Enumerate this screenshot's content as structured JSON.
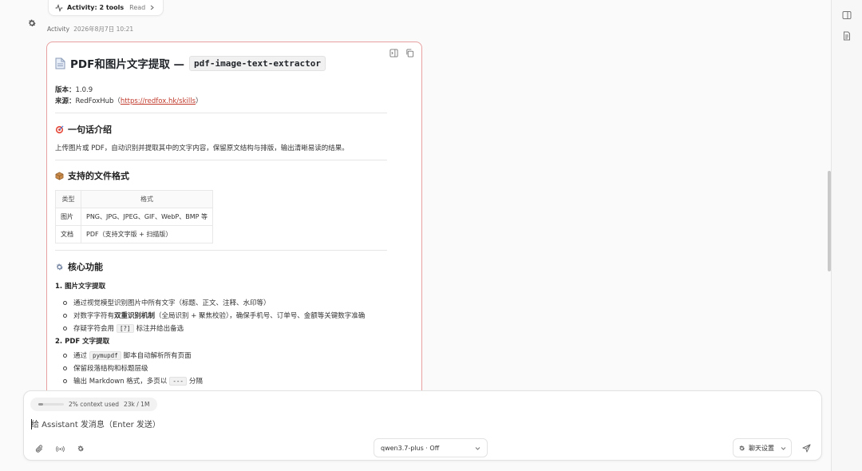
{
  "activity": {
    "pill_title": "Activity: 2 tools",
    "pill_read": "Read",
    "label": "Activity",
    "timestamp": "2026年8月7日 10:21"
  },
  "doc": {
    "title": "PDF和图片文字提取 —",
    "title_code": "pdf-image-text-extractor",
    "version_label": "版本：",
    "version_value": "1.0.9",
    "source_label": "来源：",
    "source_prefix": "RedFoxHub（",
    "source_link": "https://redfox.hk/skills",
    "source_suffix": "）",
    "intro_heading": "一句话介绍",
    "intro_text": "上传图片或 PDF，自动识别并提取其中的文字内容，保留原文结构与排版，输出清晰易读的结果。",
    "formats_heading": "支持的文件格式",
    "table_headers": [
      "类型",
      "格式"
    ],
    "table_rows": [
      [
        "图片",
        "PNG、JPG、JPEG、GIF、WebP、BMP 等"
      ],
      [
        "文档",
        "PDF（支持文字版 + 扫描版）"
      ]
    ],
    "core_heading": "核心功能",
    "sec1_title": "1. 图片文字提取",
    "sec1_item1": "通过视觉模型识别图片中所有文字（标题、正文、注释、水印等）",
    "sec1_item2_pre": "对数字字符有",
    "sec1_item2_bold": "双重识别机制",
    "sec1_item2_post": "（全局识别 + 聚焦校验），确保手机号、订单号、金额等关键数字准确",
    "sec1_item3_pre": "存疑字符会用",
    "sec1_item3_code": "[?]",
    "sec1_item3_post": "标注并给出备选",
    "sec2_title": "2. PDF 文字提取",
    "sec2_item1_pre": "通过",
    "sec2_item1_code": "pymupdf",
    "sec2_item1_post": "脚本自动解析所有页面",
    "sec2_item2": "保留段落结构和标题层级",
    "sec2_item3_pre": "输出 Markdown 格式，多页以",
    "sec2_item3_code": "---",
    "sec2_item3_post": "分隔"
  },
  "composer": {
    "context_text": "2% context used",
    "context_tokens": "23k / 1M",
    "context_fraction": 0.02,
    "placeholder": "给 Assistant 发消息（Enter 发送）",
    "model": "qwen3.7-plus · Off",
    "chat_settings": "聊天设置"
  },
  "icons": {
    "settings": "gear-icon",
    "activity": "activity-pulse-icon",
    "doc": "document-icon",
    "intro": "target-icon",
    "formats": "package-icon",
    "core": "gear-icon",
    "attach": "paperclip-icon",
    "broadcast": "broadcast-icon",
    "send": "send-icon"
  },
  "colors": {
    "card_border": "#e8a0a0",
    "link": "#c0392b"
  }
}
